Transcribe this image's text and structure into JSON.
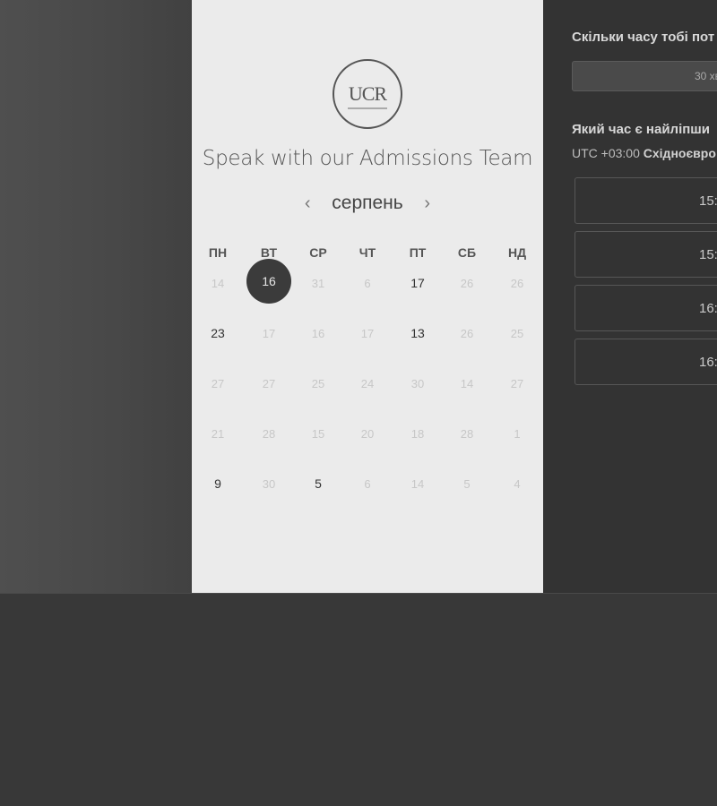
{
  "logo": {
    "text": "UCR"
  },
  "panel": {
    "title": "Speak with our Admissions Team"
  },
  "calendar": {
    "month": "серпень",
    "prev_icon": "chevron-left-icon",
    "next_icon": "chevron-right-icon",
    "weekdays": [
      "ПН",
      "ВТ",
      "СР",
      "ЧТ",
      "ПТ",
      "СБ",
      "НД"
    ],
    "weeks": [
      [
        {
          "d": "14",
          "state": "inactive"
        },
        {
          "d": "16",
          "state": "selected"
        },
        {
          "d": "31",
          "state": "inactive"
        },
        {
          "d": "6",
          "state": "inactive"
        },
        {
          "d": "17",
          "state": "active"
        },
        {
          "d": "26",
          "state": "inactive"
        },
        {
          "d": "26",
          "state": "inactive"
        }
      ],
      [
        {
          "d": "23",
          "state": "active"
        },
        {
          "d": "17",
          "state": "inactive"
        },
        {
          "d": "16",
          "state": "inactive"
        },
        {
          "d": "17",
          "state": "inactive"
        },
        {
          "d": "13",
          "state": "active"
        },
        {
          "d": "26",
          "state": "inactive"
        },
        {
          "d": "25",
          "state": "inactive"
        }
      ],
      [
        {
          "d": "27",
          "state": "inactive"
        },
        {
          "d": "27",
          "state": "inactive"
        },
        {
          "d": "25",
          "state": "inactive"
        },
        {
          "d": "24",
          "state": "inactive"
        },
        {
          "d": "30",
          "state": "inactive"
        },
        {
          "d": "14",
          "state": "inactive"
        },
        {
          "d": "27",
          "state": "inactive"
        }
      ],
      [
        {
          "d": "21",
          "state": "inactive"
        },
        {
          "d": "28",
          "state": "inactive"
        },
        {
          "d": "15",
          "state": "inactive"
        },
        {
          "d": "20",
          "state": "inactive"
        },
        {
          "d": "18",
          "state": "inactive"
        },
        {
          "d": "28",
          "state": "inactive"
        },
        {
          "d": "1",
          "state": "inactive"
        }
      ],
      [
        {
          "d": "9",
          "state": "active"
        },
        {
          "d": "30",
          "state": "inactive"
        },
        {
          "d": "5",
          "state": "active"
        },
        {
          "d": "6",
          "state": "inactive"
        },
        {
          "d": "14",
          "state": "inactive"
        },
        {
          "d": "5",
          "state": "inactive"
        },
        {
          "d": "4",
          "state": "inactive"
        }
      ]
    ]
  },
  "booking": {
    "duration_question": "Скільки часу тобі пот",
    "duration_value": "30 хв",
    "time_question": "Який час є найліпши",
    "timezone_prefix": "UTC +03:00",
    "timezone_name": "Східноєвро",
    "slots": [
      "15:",
      "15:",
      "16:",
      "16:"
    ]
  }
}
